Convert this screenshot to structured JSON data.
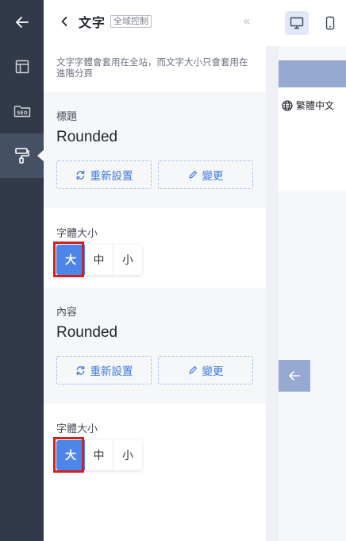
{
  "rail": {
    "items": [
      {
        "name": "back",
        "icon": "arrow-left-icon"
      },
      {
        "name": "layout",
        "icon": "layout-icon"
      },
      {
        "name": "seo",
        "icon": "seo-folder-icon",
        "label": "SEO"
      },
      {
        "name": "style",
        "icon": "paint-roller-icon",
        "active": true
      }
    ]
  },
  "panel": {
    "title": "文字",
    "tag": "全域控制",
    "collapse_glyph": "«",
    "description": "文字字體會套用在全站，而文字大小只會套用在進階分頁"
  },
  "title_section": {
    "label": "標題",
    "font": "Rounded",
    "reset_label": "重新設置",
    "change_label": "變更"
  },
  "title_size": {
    "label": "字體大小",
    "options": [
      "大",
      "中",
      "小"
    ],
    "selected": "大"
  },
  "content_section": {
    "label": "內容",
    "font": "Rounded",
    "reset_label": "重新設置",
    "change_label": "變更"
  },
  "content_size": {
    "label": "字體大小",
    "options": [
      "大",
      "中",
      "小"
    ],
    "selected": "大"
  },
  "preview": {
    "devices": [
      {
        "name": "desktop",
        "icon": "monitor-icon",
        "active": true
      },
      {
        "name": "mobile",
        "icon": "phone-icon",
        "active": false
      }
    ],
    "language_label": "繁體中文",
    "arrow_icon": "arrow-left-icon"
  },
  "colors": {
    "rail": "#323a4a",
    "accent": "#4b86e8",
    "highlight": "#d61f1f",
    "preview_accent": "#95a9d1"
  }
}
